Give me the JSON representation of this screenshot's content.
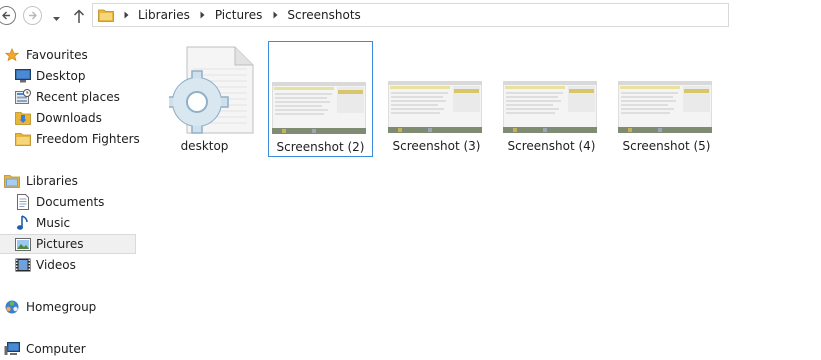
{
  "breadcrumb": [
    "Libraries",
    "Pictures",
    "Screenshots"
  ],
  "nav_pane": {
    "favourites": {
      "label": "Favourites",
      "items": [
        {
          "label": "Desktop",
          "icon": "desktop-icon"
        },
        {
          "label": "Recent places",
          "icon": "recent-places-icon"
        },
        {
          "label": "Downloads",
          "icon": "downloads-folder-icon"
        },
        {
          "label": "Freedom Fighters",
          "icon": "folder-icon"
        }
      ]
    },
    "libraries": {
      "label": "Libraries",
      "items": [
        {
          "label": "Documents",
          "icon": "documents-icon"
        },
        {
          "label": "Music",
          "icon": "music-icon"
        },
        {
          "label": "Pictures",
          "icon": "pictures-icon",
          "selected": true
        },
        {
          "label": "Videos",
          "icon": "videos-icon"
        }
      ]
    },
    "homegroup": {
      "label": "Homegroup"
    },
    "computer": {
      "label": "Computer"
    }
  },
  "files": [
    {
      "name": "desktop",
      "type": "system-file",
      "icon": "gear-file-icon"
    },
    {
      "name": "Screenshot (2)",
      "type": "image",
      "selected": true
    },
    {
      "name": "Screenshot (3)",
      "type": "image"
    },
    {
      "name": "Screenshot (4)",
      "type": "image"
    },
    {
      "name": "Screenshot (5)",
      "type": "image"
    }
  ],
  "colors": {
    "selection_border": "#3c8cd9",
    "nav_selected_bg": "#f0f0f0",
    "folder_yellow": "#e8b73a",
    "star_gold": "#f2a92b"
  }
}
